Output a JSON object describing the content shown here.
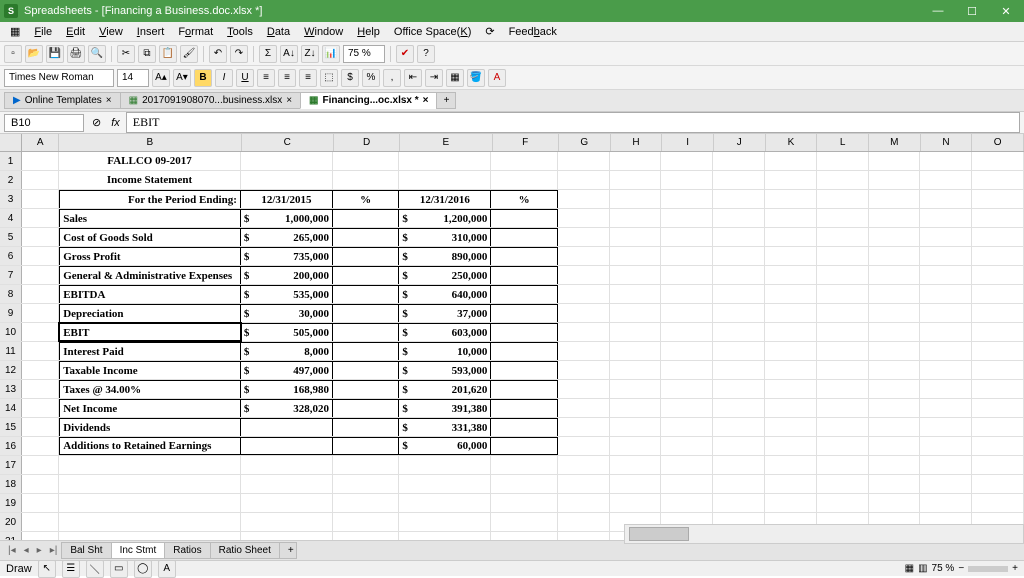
{
  "window": {
    "app_logo": "S",
    "title": "Spreadsheets - [Financing a Business.doc.xlsx *]",
    "min": "—",
    "max": "☐",
    "close": "✕"
  },
  "menu": {
    "file": "File",
    "edit": "Edit",
    "view": "View",
    "insert": "Insert",
    "format": "Format",
    "tools": "Tools",
    "data": "Data",
    "window": "Window",
    "help": "Help",
    "office_space": "Office Space(K)",
    "feedback": "Feedback"
  },
  "format_bar": {
    "font": "Times New Roman",
    "size": "14",
    "zoom_toolbar": "75 %"
  },
  "doc_tabs": {
    "templates": "Online Templates",
    "t1": "2017091908070...business.xlsx",
    "t2": "Financing...oc.xlsx *"
  },
  "cellref": {
    "name": "B10",
    "fx": "fx",
    "formula": "EBIT"
  },
  "cols": [
    "A",
    "B",
    "C",
    "D",
    "E",
    "F",
    "G",
    "H",
    "I",
    "J",
    "K",
    "L",
    "M",
    "N",
    "O"
  ],
  "rows_count": 21,
  "sheet": {
    "r1": {
      "B": "FALLCO 09-2017"
    },
    "r2": {
      "B": "Income Statement"
    },
    "r3": {
      "B": "For the Period Ending:",
      "C": "12/31/2015",
      "D": "%",
      "E": "12/31/2016",
      "F": "%"
    },
    "r4": {
      "B": "Sales",
      "Cc": "$",
      "C": "1,000,000",
      "Ec": "$",
      "E": "1,200,000"
    },
    "r5": {
      "B": "Cost of Goods Sold",
      "Cc": "$",
      "C": "265,000",
      "Ec": "$",
      "E": "310,000"
    },
    "r6": {
      "B": "Gross Profit",
      "Cc": "$",
      "C": "735,000",
      "Ec": "$",
      "E": "890,000"
    },
    "r7": {
      "B": "General & Administrative Expenses",
      "Cc": "$",
      "C": "200,000",
      "Ec": "$",
      "E": "250,000"
    },
    "r8": {
      "B": "EBITDA",
      "Cc": "$",
      "C": "535,000",
      "Ec": "$",
      "E": "640,000"
    },
    "r9": {
      "B": "Depreciation",
      "Cc": "$",
      "C": "30,000",
      "Ec": "$",
      "E": "37,000"
    },
    "r10": {
      "B": "EBIT",
      "Cc": "$",
      "C": "505,000",
      "Ec": "$",
      "E": "603,000"
    },
    "r11": {
      "B": "Interest Paid",
      "Cc": "$",
      "C": "8,000",
      "Ec": "$",
      "E": "10,000"
    },
    "r12": {
      "B": "Taxable Income",
      "Cc": "$",
      "C": "497,000",
      "Ec": "$",
      "E": "593,000"
    },
    "r13": {
      "B": "Taxes @ 34.00%",
      "Cc": "$",
      "C": "168,980",
      "Ec": "$",
      "E": "201,620"
    },
    "r14": {
      "B": "Net Income",
      "Cc": "$",
      "C": "328,020",
      "Ec": "$",
      "E": "391,380"
    },
    "r15": {
      "B": "Dividends",
      "Ec": "$",
      "E": "331,380"
    },
    "r16": {
      "B": "Additions to Retained Earnings",
      "Ec": "$",
      "E": "60,000"
    }
  },
  "sheet_tabs": {
    "t1": "Bal Sht",
    "t2": "Inc Stmt",
    "t3": "Ratios",
    "t4": "Ratio Sheet"
  },
  "draw_label": "Draw",
  "status": {
    "zoom": "75 %"
  }
}
